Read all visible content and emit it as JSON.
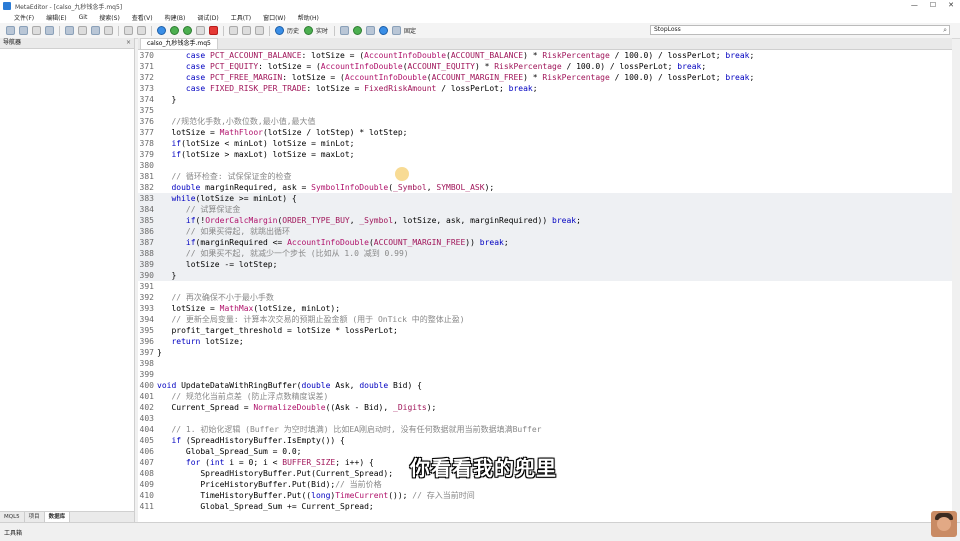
{
  "window": {
    "title": "MetaEditor - [calso_九秒钱念手.mq5]",
    "controls": [
      "—",
      "☐",
      "✕"
    ]
  },
  "menu": [
    "文件(F)",
    "编辑(E)",
    "Git",
    "搜索(S)",
    "查看(V)",
    "构建(B)",
    "调试(D)",
    "工具(T)",
    "窗口(W)",
    "帮助(H)"
  ],
  "toolbar": {
    "history_label": "历史",
    "realtime_label": "实时",
    "pin_label": "固定",
    "search_value": "StopLoss"
  },
  "navigator": {
    "title": "导航器",
    "tabs": [
      "MQL5",
      "项目",
      "数据库"
    ],
    "active_tab": "数据库"
  },
  "document": {
    "tab_label": "calso_九秒钱念手.mq5"
  },
  "code_lines": [
    {
      "n": "370",
      "code": "      case PCT_ACCOUNT_BALANCE: lotSize = (AccountInfoDouble(ACCOUNT_BALANCE) * RiskPercentage / 100.0) / lossPerLot; break;"
    },
    {
      "n": "371",
      "code": "      case PCT_EQUITY: lotSize = (AccountInfoDouble(ACCOUNT_EQUITY) * RiskPercentage / 100.0) / lossPerLot; break;"
    },
    {
      "n": "372",
      "code": "      case PCT_FREE_MARGIN: lotSize = (AccountInfoDouble(ACCOUNT_MARGIN_FREE) * RiskPercentage / 100.0) / lossPerLot; break;"
    },
    {
      "n": "373",
      "code": "      case FIXED_RISK_PER_TRADE: lotSize = FixedRiskAmount / lossPerLot; break;"
    },
    {
      "n": "374",
      "code": "   }"
    },
    {
      "n": "375",
      "code": ""
    },
    {
      "n": "376",
      "code": "   //规范化手数,小数位数,最小值,最大值"
    },
    {
      "n": "377",
      "code": "   lotSize = MathFloor(lotSize / lotStep) * lotStep;"
    },
    {
      "n": "378",
      "code": "   if(lotSize < minLot) lotSize = minLot;"
    },
    {
      "n": "379",
      "code": "   if(lotSize > maxLot) lotSize = maxLot;"
    },
    {
      "n": "380",
      "code": ""
    },
    {
      "n": "381",
      "code": "   // 循环检查: 试保保证金的检查"
    },
    {
      "n": "382",
      "code": "   double marginRequired, ask = SymbolInfoDouble(_Symbol, SYMBOL_ASK);"
    },
    {
      "n": "383",
      "code": "   while(lotSize >= minLot) {"
    },
    {
      "n": "384",
      "code": "      // 试算保证金"
    },
    {
      "n": "385",
      "code": "      if(!OrderCalcMargin(ORDER_TYPE_BUY, _Symbol, lotSize, ask, marginRequired)) break;"
    },
    {
      "n": "386",
      "code": "      // 如果买得起, 就跳出循环"
    },
    {
      "n": "387",
      "code": "      if(marginRequired <= AccountInfoDouble(ACCOUNT_MARGIN_FREE)) break;"
    },
    {
      "n": "388",
      "code": "      // 如果买不起, 就减少一个步长 (比如从 1.0 减到 0.99)"
    },
    {
      "n": "389",
      "code": "      lotSize -= lotStep;"
    },
    {
      "n": "390",
      "code": "   }"
    },
    {
      "n": "391",
      "code": ""
    },
    {
      "n": "392",
      "code": "   // 再次确保不小于最小手数"
    },
    {
      "n": "393",
      "code": "   lotSize = MathMax(lotSize, minLot);"
    },
    {
      "n": "394",
      "code": "   // 更新全局变量: 计算本次交易的预期止盈金额 (用于 OnTick 中的整体止盈)"
    },
    {
      "n": "395",
      "code": "   profit_target_threshold = lotSize * lossPerLot;"
    },
    {
      "n": "396",
      "code": "   return lotSize;"
    },
    {
      "n": "397",
      "code": "}"
    },
    {
      "n": "398",
      "code": ""
    },
    {
      "n": "399",
      "code": ""
    },
    {
      "n": "400",
      "code": "void UpdateDataWithRingBuffer(double Ask, double Bid) {"
    },
    {
      "n": "401",
      "code": "   // 规范化当前点差 (防止浮点数精度误差)"
    },
    {
      "n": "402",
      "code": "   Current_Spread = NormalizeDouble((Ask - Bid), _Digits);"
    },
    {
      "n": "403",
      "code": ""
    },
    {
      "n": "404",
      "code": "   // 1. 初始化逻辑 (Buffer 为空时填满) 比如EA刚启动时, 没有任何数据就用当前数据填满Buffer"
    },
    {
      "n": "405",
      "code": "   if (SpreadHistoryBuffer.IsEmpty()) {"
    },
    {
      "n": "406",
      "code": "      Global_Spread_Sum = 0.0;"
    },
    {
      "n": "407",
      "code": "      for (int i = 0; i < BUFFER_SIZE; i++) {"
    },
    {
      "n": "408",
      "code": "         SpreadHistoryBuffer.Put(Current_Spread);"
    },
    {
      "n": "409",
      "code": "         PriceHistoryBuffer.Put(Bid);// 当前价格"
    },
    {
      "n": "410",
      "code": "         TimeHistoryBuffer.Put((long)TimeCurrent()); // 存入当前时间"
    },
    {
      "n": "411",
      "code": "         Global_Spread_Sum += Current_Spread;"
    }
  ],
  "status": {
    "label": "工具箱"
  },
  "subtitle": "你看看我的兜里"
}
